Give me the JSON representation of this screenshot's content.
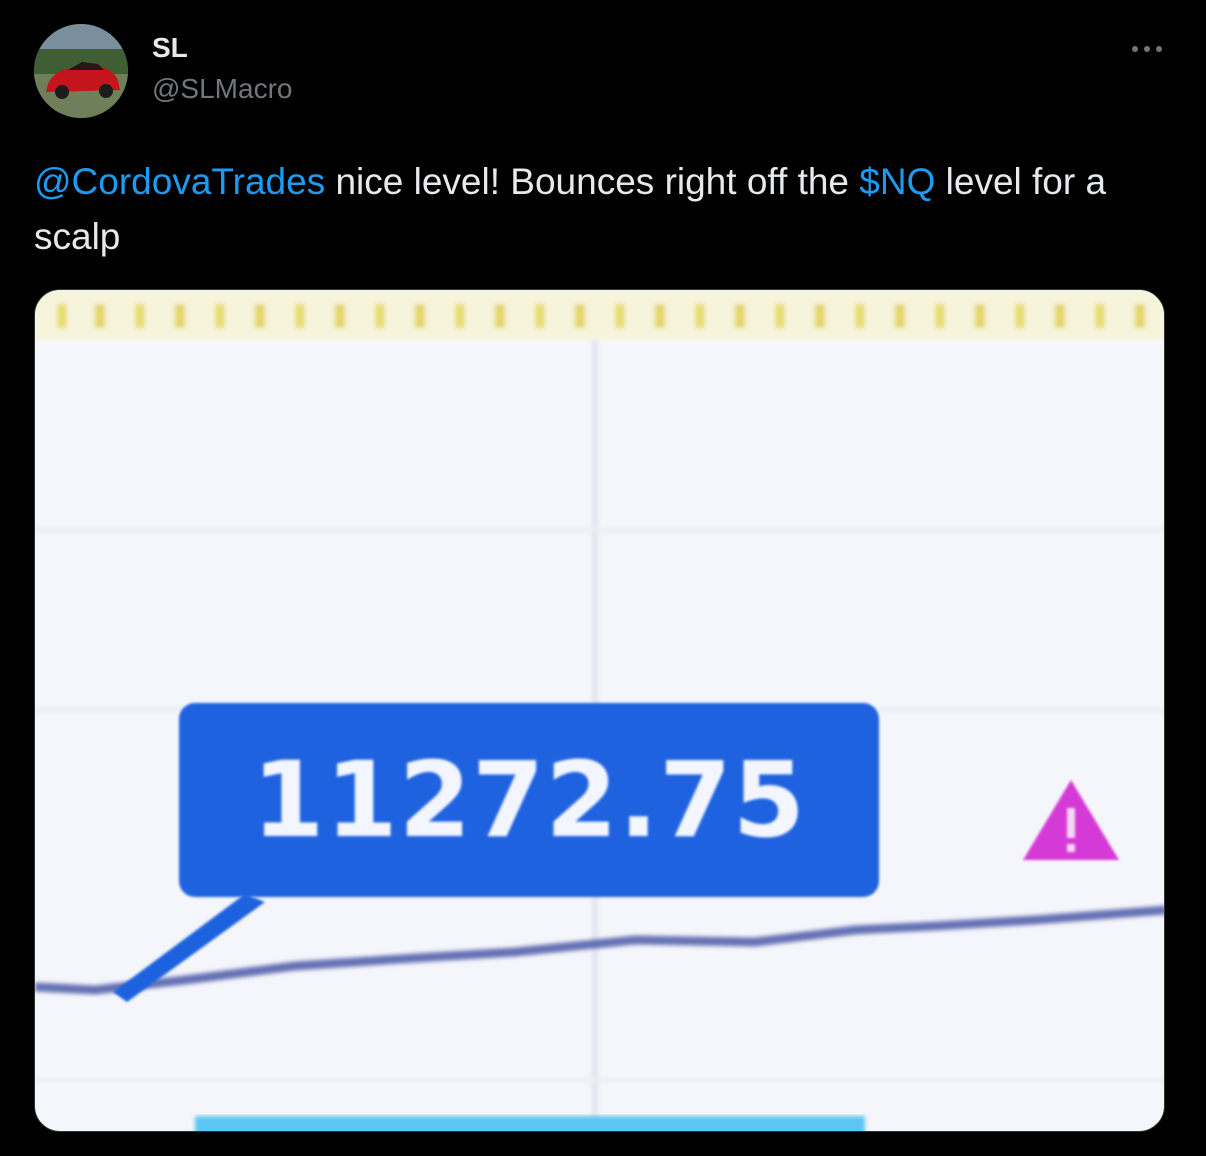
{
  "author": {
    "display_name": "SL",
    "handle": "@SLMacro",
    "avatar_icon": "red-sports-car-avatar"
  },
  "menu": {
    "icon": "more-options-icon"
  },
  "tweet": {
    "mention": "@CordovaTrades",
    "text_part1": " nice level! Bounces right off the ",
    "cashtag": "$NQ",
    "text_part2": " level for a scalp"
  },
  "media": {
    "price_label": "11272.75",
    "warning_icon": "warning-triangle-icon",
    "label_color": "#1e62df",
    "warning_color": "#d63ad6",
    "line_color": "#4b5ba8",
    "background_color": "#f5f6fb"
  },
  "colors": {
    "background": "#000000",
    "text": "#e7e9ea",
    "secondary_text": "#71767b",
    "link": "#1d9bf0"
  }
}
